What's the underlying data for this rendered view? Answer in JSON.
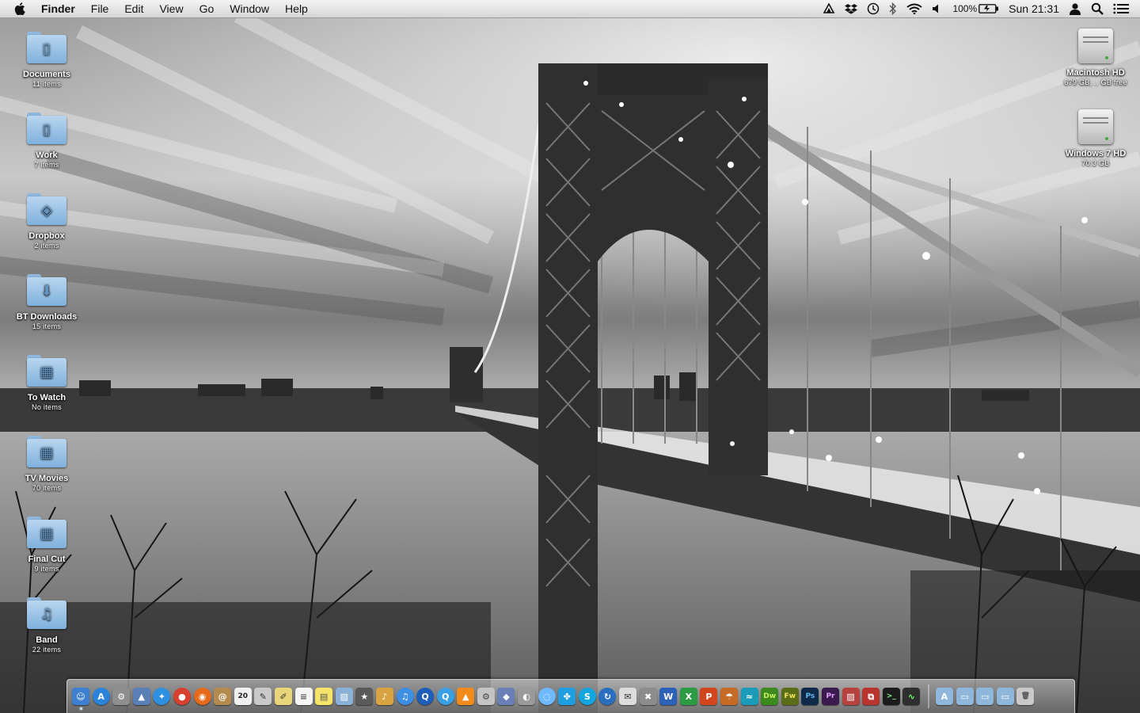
{
  "menubar": {
    "apple_icon": "apple-logo-icon",
    "menus": [
      "Finder",
      "File",
      "Edit",
      "View",
      "Go",
      "Window",
      "Help"
    ],
    "status_icons": [
      "cloud-upload-icon",
      "dropbox-icon",
      "time-machine-icon",
      "bluetooth-icon",
      "wifi-icon",
      "volume-icon"
    ],
    "battery_percent": "100%",
    "battery_icon": "battery-charging-icon",
    "clock": "Sun 21:31",
    "user_icon": "user-icon",
    "spotlight_icon": "spotlight-search-icon",
    "list_icon": "notification-list-icon"
  },
  "desktop": {
    "left_icons": [
      {
        "name": "Documents",
        "sub": "11 items",
        "emblem": "document-emblem"
      },
      {
        "name": "Work",
        "sub": "7 items",
        "emblem": "document-emblem"
      },
      {
        "name": "Dropbox",
        "sub": "2 items",
        "emblem": "dropbox-emblem"
      },
      {
        "name": "BT Downloads",
        "sub": "15 items",
        "emblem": "download-emblem"
      },
      {
        "name": "To Watch",
        "sub": "No items",
        "emblem": "film-emblem"
      },
      {
        "name": "TV Movies",
        "sub": "70 items",
        "emblem": "film-emblem"
      },
      {
        "name": "Final Cut",
        "sub": "9 items",
        "emblem": "film-emblem"
      },
      {
        "name": "Band",
        "sub": "22 items",
        "emblem": "music-emblem"
      }
    ],
    "right_icons": [
      {
        "name": "Macintosh HD",
        "sub": "679 GB, .. GB free"
      },
      {
        "name": "Windows 7 HD",
        "sub": "70.3 GB"
      }
    ]
  },
  "dock": {
    "apps": [
      {
        "name": "finder",
        "glyph": "☺",
        "color": "#3d7fd0",
        "running": true
      },
      {
        "name": "app-store",
        "glyph": "A",
        "color": "#2a83d8",
        "round": true
      },
      {
        "name": "system-preferences",
        "glyph": "⚙",
        "color": "#8e8e8e"
      },
      {
        "name": "preview",
        "glyph": "▲",
        "color": "#5a7fb5"
      },
      {
        "name": "safari",
        "glyph": "✦",
        "color": "#2f8fe0",
        "round": true
      },
      {
        "name": "chrome",
        "glyph": "●",
        "color": "#d8412f",
        "round": true
      },
      {
        "name": "firefox",
        "glyph": "◉",
        "color": "#e76a1a",
        "round": true
      },
      {
        "name": "address-book",
        "glyph": "@",
        "color": "#b48a4f"
      },
      {
        "name": "ical",
        "glyph": "20",
        "color": "#f0f0f0",
        "text": "#222"
      },
      {
        "name": "photo-editor",
        "glyph": "✎",
        "color": "#c9c9c9",
        "text": "#333"
      },
      {
        "name": "script-editor",
        "glyph": "✐",
        "color": "#e9d67a",
        "text": "#333"
      },
      {
        "name": "textedit",
        "glyph": "≡",
        "color": "#f5f5f5",
        "text": "#555"
      },
      {
        "name": "stickies",
        "glyph": "▤",
        "color": "#f6e36a",
        "text": "#555"
      },
      {
        "name": "iphoto",
        "glyph": "▧",
        "color": "#8ab2d9"
      },
      {
        "name": "imovie",
        "glyph": "★",
        "color": "#5a5a5a"
      },
      {
        "name": "garageband",
        "glyph": "♪",
        "color": "#d8a441"
      },
      {
        "name": "itunes",
        "glyph": "♫",
        "color": "#3c8fe3",
        "round": true
      },
      {
        "name": "quicktime",
        "glyph": "Q",
        "color": "#1d5fb8",
        "round": true
      },
      {
        "name": "quicktime-x",
        "glyph": "Q",
        "color": "#3aa0e6",
        "round": true
      },
      {
        "name": "vlc",
        "glyph": "▲",
        "color": "#f28b1b"
      },
      {
        "name": "automator",
        "glyph": "⚙",
        "color": "#c4c4c4",
        "text": "#444"
      },
      {
        "name": "virtualbox",
        "glyph": "◆",
        "color": "#6a7fb5"
      },
      {
        "name": "facetime",
        "glyph": "◐",
        "color": "#9a9a9a"
      },
      {
        "name": "ichat",
        "glyph": "◌",
        "color": "#6fb9ff",
        "round": true
      },
      {
        "name": "messenger",
        "glyph": "✤",
        "color": "#1f9fe2"
      },
      {
        "name": "skype",
        "glyph": "S",
        "color": "#12a5e0",
        "round": true
      },
      {
        "name": "instastats",
        "glyph": "↻",
        "color": "#2a6fbf",
        "round": true
      },
      {
        "name": "mail",
        "glyph": "✉",
        "color": "#dcdcdc",
        "text": "#333"
      },
      {
        "name": "bone-app",
        "glyph": "✖",
        "color": "#8c8c8c"
      },
      {
        "name": "word",
        "glyph": "W",
        "color": "#2d61b8"
      },
      {
        "name": "excel",
        "glyph": "X",
        "color": "#2c9b43"
      },
      {
        "name": "powerpoint",
        "glyph": "P",
        "color": "#d2461e"
      },
      {
        "name": "cyberduck",
        "glyph": "☂",
        "color": "#c56b26"
      },
      {
        "name": "network-app",
        "glyph": "≈",
        "color": "#1a9cb8"
      },
      {
        "name": "dreamweaver",
        "glyph": "Dw",
        "color": "#3c8a1e",
        "text": "#c9f060"
      },
      {
        "name": "fireworks",
        "glyph": "Fw",
        "color": "#5a6e17",
        "text": "#f3e05a"
      },
      {
        "name": "photoshop",
        "glyph": "Ps",
        "color": "#0f2a48",
        "text": "#5fb7ef"
      },
      {
        "name": "premiere",
        "glyph": "Pr",
        "color": "#3b1b4d",
        "text": "#e3a0ff"
      },
      {
        "name": "photo-booth",
        "glyph": "▨",
        "color": "#b5423e"
      },
      {
        "name": "parallels",
        "glyph": "⧉",
        "color": "#b8342f"
      },
      {
        "name": "terminal",
        "glyph": ">_",
        "color": "#1c1c1c",
        "text": "#8cf28c"
      },
      {
        "name": "activity-monitor",
        "glyph": "∿",
        "color": "#2f2f2f",
        "text": "#6ef06e"
      }
    ],
    "stacks": [
      {
        "name": "applications-stack",
        "glyph": "A",
        "color": "#8fb7dc"
      },
      {
        "name": "documents-stack",
        "glyph": "▭",
        "color": "#8fb7dc"
      },
      {
        "name": "downloads-stack",
        "glyph": "▭",
        "color": "#8fb7dc"
      },
      {
        "name": "work-stack",
        "glyph": "▭",
        "color": "#8fb7dc"
      },
      {
        "name": "trash",
        "glyph": "🗑",
        "color": "#c9c9c9",
        "text": "#555"
      }
    ]
  }
}
